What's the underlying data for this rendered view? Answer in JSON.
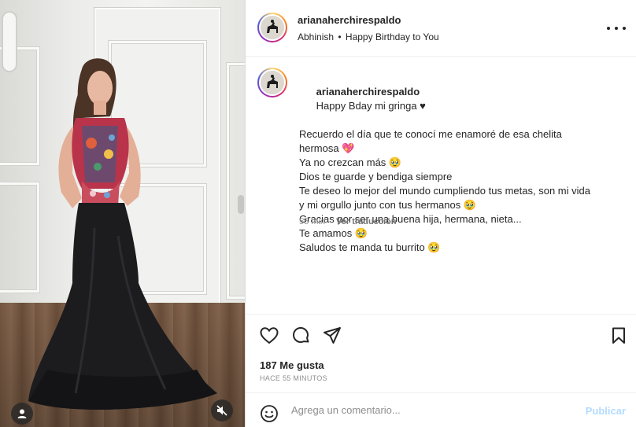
{
  "header": {
    "username": "arianaherchirespaldo",
    "audio_artist": "Abhinish",
    "audio_separator": "•",
    "audio_track": "Happy Birthday to You"
  },
  "caption": {
    "username": "arianaherchirespaldo",
    "first_line": "Happy Bday mi gringa ♥",
    "lines": [
      "Recuerdo el día que te conocí me enamoré de esa chelita",
      "hermosa 💖",
      "Ya no crezcan más 🥹",
      "Dios te guarde y bendiga siempre",
      "Te deseo lo mejor del mundo cumpliendo tus metas, son mi vida",
      "y mi orgullo junto con tus hermanos 🥹",
      "Gracias por ser una buena hija, hermana, nieta...",
      "Te amamos 🥹",
      "Saludos te manda tu burrito 🥹"
    ],
    "age": "55 min",
    "translate": "Ver traducción"
  },
  "stats": {
    "likes": "187 Me gusta",
    "timestamp": "HACE 55 MINUTOS"
  },
  "comment": {
    "placeholder": "Agrega un comentario...",
    "post_label": "Publicar"
  },
  "icons": {
    "like": "heart-icon",
    "comment": "comment-icon",
    "share": "send-icon",
    "save": "bookmark-icon",
    "more": "more-icon",
    "emoji": "emoji-icon",
    "tagged_user": "user-icon",
    "mute": "muted-speaker-icon"
  },
  "colors": {
    "post_disabled": "#b3dbff",
    "text": "#262626",
    "secondary": "#8e8e8e"
  }
}
